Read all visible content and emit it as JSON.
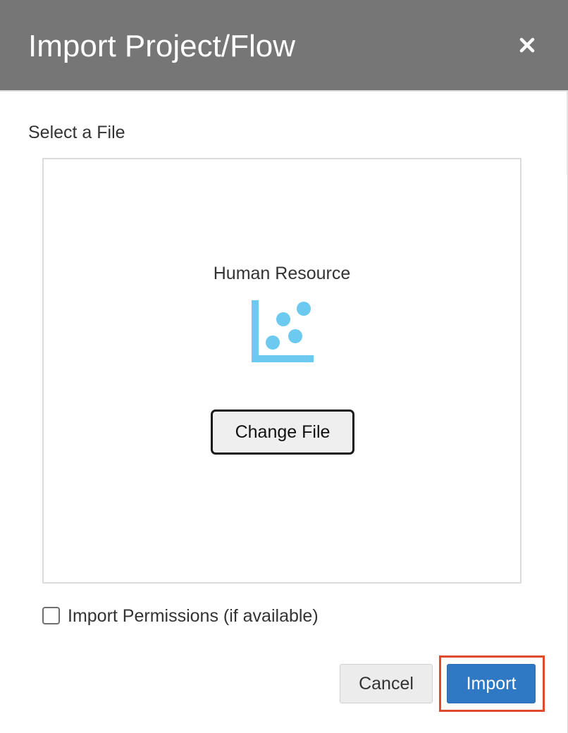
{
  "dialog": {
    "title": "Import Project/Flow",
    "close_icon": "close-icon"
  },
  "file_section": {
    "label": "Select a File",
    "file_name": "Human Resource",
    "file_icon": "scatter-chart-icon",
    "change_button": "Change File"
  },
  "permissions": {
    "label": "Import Permissions (if available)",
    "checked": false
  },
  "footer": {
    "cancel_label": "Cancel",
    "import_label": "Import"
  },
  "colors": {
    "header_bg": "#767676",
    "icon_blue": "#6ccaf0",
    "primary_button": "#2f79c4",
    "highlight_border": "#e04a2c"
  }
}
